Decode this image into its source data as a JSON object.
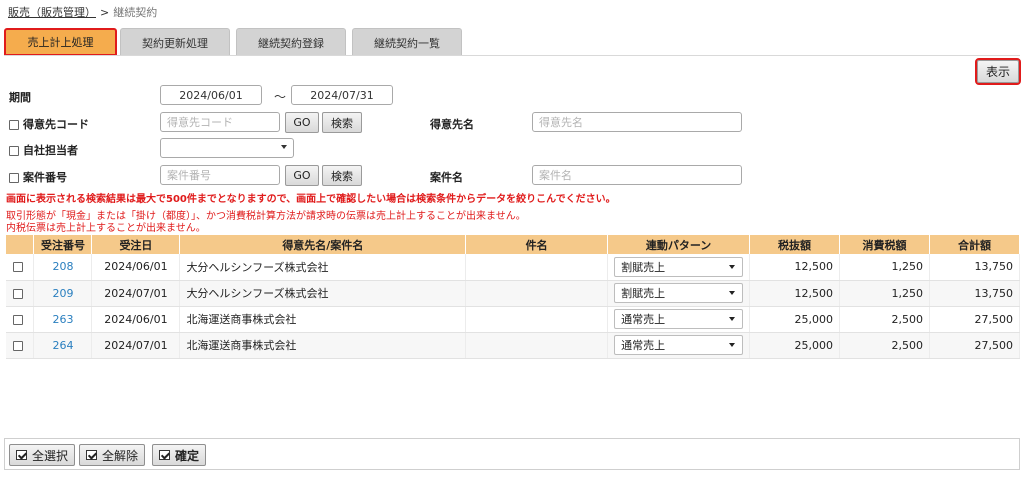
{
  "breadcrumb": {
    "parent": "販売（販売管理）",
    "separator": ">",
    "current": "継続契約"
  },
  "tabs": [
    {
      "label": "売上計上処理",
      "active": true
    },
    {
      "label": "契約更新処理",
      "active": false
    },
    {
      "label": "継続契約登録",
      "active": false
    },
    {
      "label": "継続契約一覧",
      "active": false
    }
  ],
  "display_button": "表示",
  "filters": {
    "period_label": "期間",
    "date_from": "2024/06/01",
    "tilde": "～",
    "date_to": "2024/07/31",
    "customer_code_label": "得意先コード",
    "customer_code_placeholder": "得意先コード",
    "go_label": "GO",
    "search_label": "検索",
    "customer_name_label": "得意先名",
    "customer_name_placeholder": "得意先名",
    "staff_label": "自社担当者",
    "case_no_label": "案件番号",
    "case_no_placeholder": "案件番号",
    "case_name_label": "案件名",
    "case_name_placeholder": "案件名"
  },
  "notices": {
    "bold": "画面に表示される検索結果は最大で500件までとなりますので、画面上で確認したい場合は検索条件からデータを絞りこんでください。",
    "line1": "取引形態が「現金」または「掛け（都度）」、かつ消費税計算方法が請求時の伝票は売上計上することが出来ません。",
    "line2": "内税伝票は売上計上することが出来ません。"
  },
  "table": {
    "headers": [
      "",
      "受注番号",
      "受注日",
      "得意先名/案件名",
      "件名",
      "連動パターン",
      "税抜額",
      "消費税額",
      "合計額"
    ],
    "rows": [
      {
        "order_no": "208",
        "date": "2024/06/01",
        "customer": "大分ヘルシンフーズ株式会社",
        "subject": "",
        "pattern": "割賦売上",
        "net": "12,500",
        "tax": "1,250",
        "total": "13,750"
      },
      {
        "order_no": "209",
        "date": "2024/07/01",
        "customer": "大分ヘルシンフーズ株式会社",
        "subject": "",
        "pattern": "割賦売上",
        "net": "12,500",
        "tax": "1,250",
        "total": "13,750"
      },
      {
        "order_no": "263",
        "date": "2024/06/01",
        "customer": "北海運送商事株式会社",
        "subject": "",
        "pattern": "通常売上",
        "net": "25,000",
        "tax": "2,500",
        "total": "27,500"
      },
      {
        "order_no": "264",
        "date": "2024/07/01",
        "customer": "北海運送商事株式会社",
        "subject": "",
        "pattern": "通常売上",
        "net": "25,000",
        "tax": "2,500",
        "total": "27,500"
      }
    ]
  },
  "footer": {
    "select_all": "全選択",
    "deselect_all": "全解除",
    "confirm": "確定"
  }
}
